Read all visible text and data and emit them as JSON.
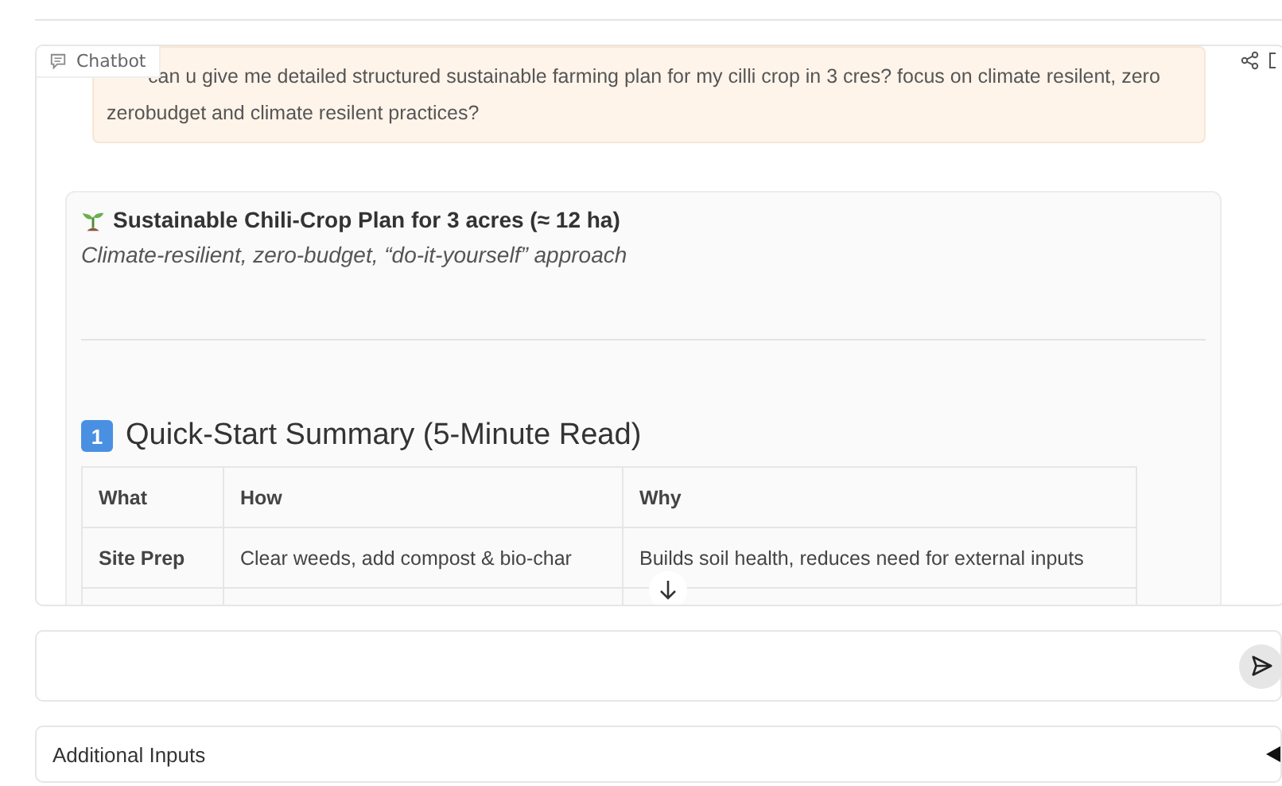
{
  "chatbot": {
    "label": "Chatbot",
    "user_message": "can u give me detailed structured sustainable farming plan for my cilli crop in 3 cres? focus on climate resilent, zero zerobudget and climate resilent practices?",
    "reply": {
      "title": "Sustainable Chili-Crop Plan for 3 acres (≈ 12 ha)",
      "subtitle": "Climate-resilient, zero-budget, “do-it-yourself” approach",
      "section_number": "1",
      "section_title": "Quick-Start Summary (5-Minute Read)",
      "table": {
        "columns": [
          "What",
          "How",
          "Why"
        ],
        "rows": [
          [
            "Site Prep",
            "Clear weeds, add compost & bio-char",
            "Builds soil health, reduces need for external inputs"
          ]
        ]
      }
    }
  },
  "additional_inputs": {
    "label": "Additional Inputs",
    "expanded": false
  }
}
